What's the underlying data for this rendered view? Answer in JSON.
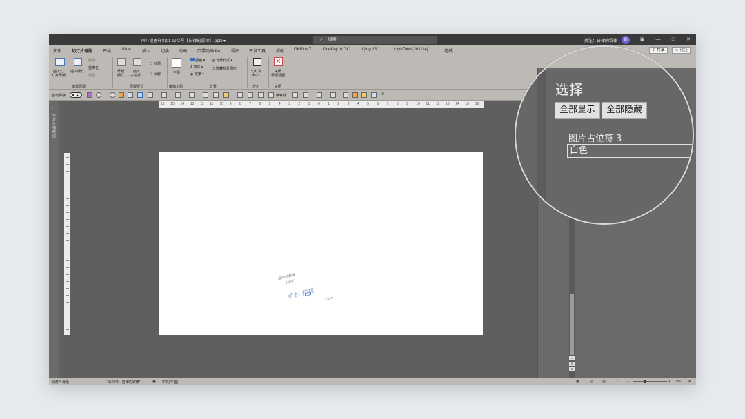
{
  "titlebar": {
    "doc_title": "PPT设备样机01-公众号【自律的霖律】.pptx  ▾",
    "search_placeholder": "搜索",
    "user": "关注：自律的霖律",
    "avatar_initial": "霖",
    "controls": [
      "▣",
      "—",
      "□",
      "✕"
    ]
  },
  "menu": {
    "tabs": [
      "文件",
      "幻灯片母版",
      "开始",
      "iSlide",
      "插入",
      "切换",
      "动画",
      "口袋动画 PA",
      "视图",
      "开发工具",
      "帮助",
      "OKPlus 7",
      "OneKey10 GC",
      "Qing 15.1",
      "LvyhTools(201114)",
      "墙纸"
    ],
    "active_index": 1,
    "share_label": "共享",
    "comment_label": "批注"
  },
  "ribbon": {
    "items": [
      "插入幻",
      "灯片母版",
      "插入版式",
      "删除",
      "重命名",
      "保留",
      "母版",
      "版式",
      "插入",
      "占位符",
      "标题",
      "页脚",
      "主题",
      "颜色",
      "字体",
      "效果",
      "背景样式",
      "隐藏背景图形",
      "幻灯片",
      "大小",
      "关闭",
      "母版视图"
    ],
    "groups": [
      "编辑母版",
      "母版版式",
      "编辑主题",
      "背景",
      "大小",
      "关闭"
    ]
  },
  "qat": {
    "autosave_label": "自动保存",
    "toggle_label": "关",
    "ref_line_label": "参考线"
  },
  "left_strip": {
    "label": "幻灯片缩略图"
  },
  "ruler": {
    "ticks": [
      "16",
      "15",
      "14",
      "13",
      "12",
      "11",
      "10",
      "9",
      "8",
      "7",
      "6",
      "5",
      "4",
      "3",
      "2",
      "1",
      "0",
      "1",
      "2",
      "3",
      "4",
      "5",
      "6",
      "7",
      "8",
      "9",
      "10",
      "11",
      "12",
      "13",
      "14",
      "15",
      "16"
    ]
  },
  "slide": {
    "wm_line1": "自律的霖律",
    "wm_line2": "PPT",
    "wm_line3": "手机 样机",
    "wm_line5": "公众号"
  },
  "statusbar": {
    "view": "幻灯片母版",
    "theme": "\"公众号：自律的霖律\"",
    "lang": "中文(中国)",
    "zoom": "75%"
  },
  "selection_pane": {
    "title": "选择",
    "show_all": "全部显示",
    "hide_all": "全部隐藏",
    "items": [
      "图片占位符 3",
      "白色"
    ],
    "selected_index": 1
  }
}
